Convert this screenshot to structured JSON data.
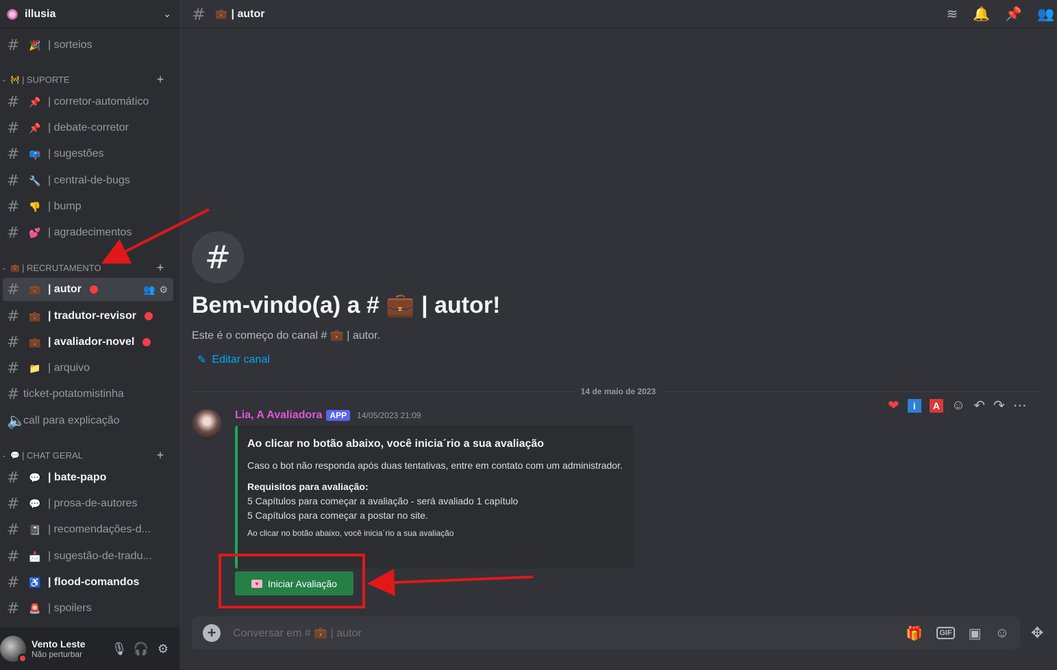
{
  "server": {
    "name": "illusia"
  },
  "sidebar": {
    "top_channel": {
      "emoji": "🎉",
      "label": "| sorteios"
    },
    "categories": [
      {
        "emoji": "🚧",
        "label": "| SUPORTE"
      },
      {
        "emoji": "💼",
        "label": "| RECRUTAMENTO"
      },
      {
        "emoji": "💬",
        "label": "| CHAT GERAL"
      }
    ],
    "suporte": [
      {
        "emoji": "📌",
        "label": "| corretor-automático"
      },
      {
        "emoji": "📌",
        "label": "| debate-corretor"
      },
      {
        "emoji": "📪",
        "label": "| sugestões"
      },
      {
        "emoji": "🔧",
        "label": "| central-de-bugs"
      },
      {
        "emoji": "👎",
        "label": "| bump"
      },
      {
        "emoji": "💕",
        "label": "| agradecimentos"
      }
    ],
    "recrutamento": [
      {
        "emoji": "💼",
        "label": "| autor"
      },
      {
        "emoji": "💼",
        "label": "| tradutor-revisor"
      },
      {
        "emoji": "💼",
        "label": "| avaliador-novel"
      },
      {
        "emoji": "📁",
        "label": "| arquivo"
      },
      {
        "emoji": "",
        "label": "ticket-potatomistinha"
      },
      {
        "emoji": "",
        "label": "call para explicação"
      }
    ],
    "chat_geral": [
      {
        "emoji": "💬",
        "label": "| bate-papo"
      },
      {
        "emoji": "💬",
        "label": "| prosa-de-autores"
      },
      {
        "emoji": "📓",
        "label": "| recomendações-d..."
      },
      {
        "emoji": "📩",
        "label": "| sugestão-de-tradu..."
      },
      {
        "emoji": "♿",
        "label": "| flood-comandos"
      },
      {
        "emoji": "🚨",
        "label": "| spoilers"
      }
    ]
  },
  "user": {
    "name": "Vento Leste",
    "status": "Não perturbar"
  },
  "channel": {
    "emoji": "💼",
    "title": "| autor"
  },
  "welcome": {
    "title": "Bem-vindo(a) a # 💼 | autor!",
    "subtitle": "Este é o começo do canal # 💼 | autor.",
    "edit": "Editar canal"
  },
  "date_divider": "14 de maio de 2023",
  "message": {
    "author": "Lia, A Avaliadora",
    "badge": "APP",
    "timestamp": "14/05/2023 21:09",
    "embed": {
      "title": "Ao clicar no botão abaixo, você inicia´rio a sua avaliação",
      "description": "Caso o bot não responda após duas tentativas, entre em contato com um administrador.",
      "requirements_title": "Requisitos para avaliação:",
      "requirement_1": "5 Capítulos para começar a avaliação - será avaliado 1 capítulo",
      "requirement_2": "5 Capítulos para começar a postar no site.",
      "footer": "Ao clicar no botão abaixo, você inicia´rio a sua avaliação"
    },
    "button_label": "Iniciar Avaliação",
    "actions": {
      "info": "i",
      "a": "A"
    }
  },
  "composer": {
    "placeholder": "Conversar em # 💼 | autor",
    "gif": "GIF"
  },
  "colors": {
    "accent_green": "#248046",
    "embed_bar": "#23a559",
    "highlight_red": "#e01818",
    "author_pink": "#e056d6",
    "link_blue": "#00a8fc"
  }
}
